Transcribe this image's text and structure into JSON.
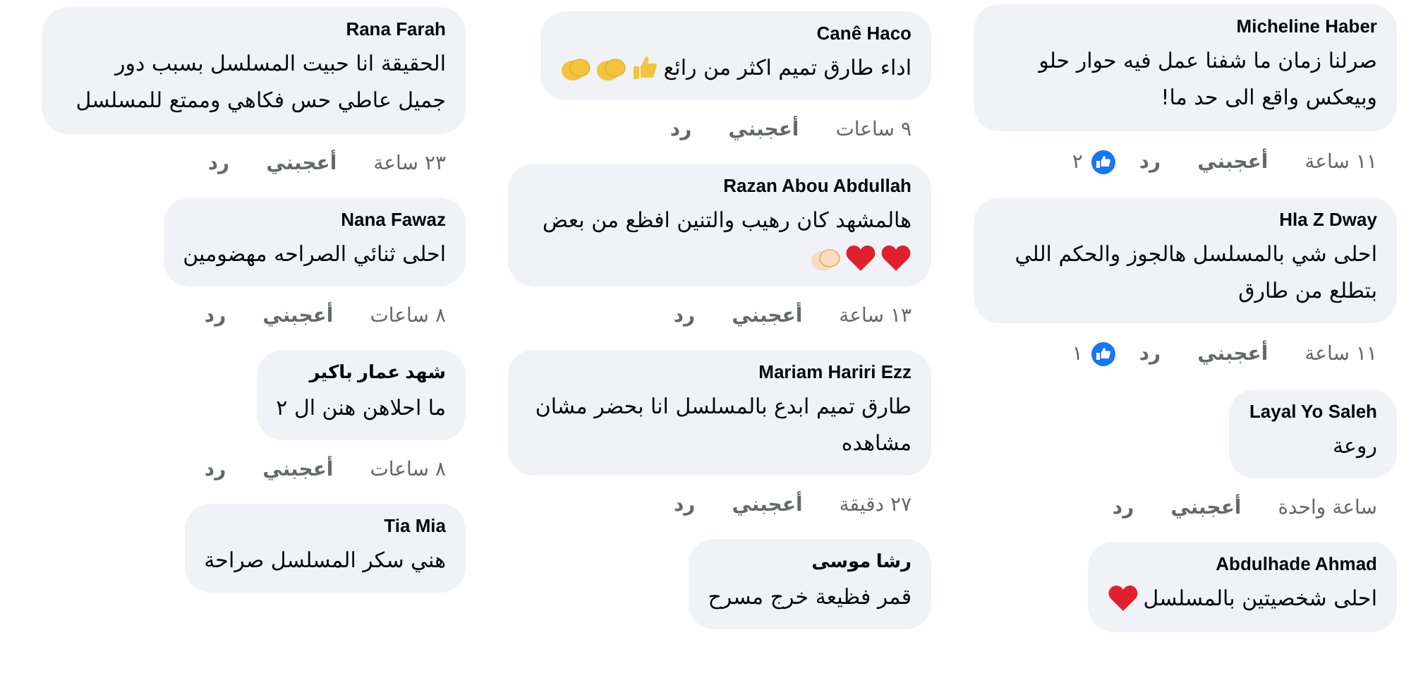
{
  "columns": [
    {
      "comments": [
        {
          "author": "Micheline Haber",
          "text": "صرلنا زمان ما شفنا عمل فيه حوار حلو وبيعكس واقع الى حد ما!",
          "time": "١١ ساعة",
          "like": "أعجبني",
          "reply": "رد",
          "likes": "٢"
        },
        {
          "author": "Hla Z Dway",
          "text": "احلى شي بالمسلسل هالجوز والحكم اللي بتطلع من طارق",
          "time": "١١ ساعة",
          "like": "أعجبني",
          "reply": "رد",
          "likes": "١"
        },
        {
          "author": "Layal Yo Saleh",
          "text": "روعة",
          "time": "ساعة واحدة",
          "like": "أعجبني",
          "reply": "رد"
        },
        {
          "author": "Abdulhade Ahmad",
          "text": "احلى شخصيتين بالمسلسل",
          "emojis": [
            {
              "kind": "heart"
            }
          ]
        }
      ]
    },
    {
      "comments": [
        {
          "author": "Canê Haco",
          "text": "اداء طارق تميم اكثر من رائع",
          "emojis": [
            {
              "kind": "thumbs-up"
            },
            {
              "kind": "clap"
            },
            {
              "kind": "clap"
            }
          ],
          "time": "٩ ساعات",
          "like": "أعجبني",
          "reply": "رد"
        },
        {
          "author": "Razan Abou Abdullah",
          "text": "هالمشهد كان رهيب والتنين افظع من بعض",
          "emojis": [
            {
              "kind": "heart"
            },
            {
              "kind": "heart"
            },
            {
              "kind": "clap-light"
            }
          ],
          "time": "١٣ ساعة",
          "like": "أعجبني",
          "reply": "رد"
        },
        {
          "author": "Mariam Hariri Ezz",
          "text": "طارق تميم ابدع بالمسلسل انا بحضر مشان مشاهده",
          "time": "٢٧ دقيقة",
          "like": "أعجبني",
          "reply": "رد"
        },
        {
          "author": "رشا موسى",
          "text": "قمر فظيعة خرج مسرح"
        }
      ]
    },
    {
      "comments": [
        {
          "author": "Rana Farah",
          "text": "الحقيقة انا حبيت المسلسل بسبب دور جميل عاطي حس فكاهي وممتع للمسلسل",
          "time": "٢٣ ساعة",
          "like": "أعجبني",
          "reply": "رد"
        },
        {
          "author": "Nana Fawaz",
          "text": "احلى ثنائي الصراحه مهضومين",
          "time": "٨ ساعات",
          "like": "أعجبني",
          "reply": "رد"
        },
        {
          "author": "شهد عمار باكير",
          "text": "ما احلاهن هنن ال ٢",
          "time": "٨ ساعات",
          "like": "أعجبني",
          "reply": "رد"
        },
        {
          "author": "Tia Mia",
          "text": "هني سكر المسلسل صراحة"
        }
      ]
    }
  ]
}
